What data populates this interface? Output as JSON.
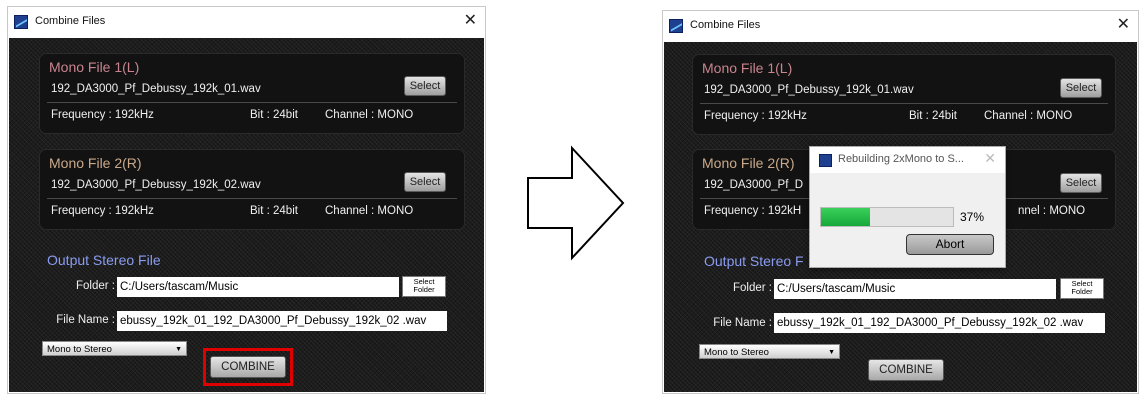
{
  "left_window": {
    "title": "Combine Files",
    "close_glyph": "✕",
    "mono1": {
      "title": "Mono File 1(L)",
      "file": "192_DA3000_Pf_Debussy_192k_01.wav",
      "select": "Select",
      "frequency": "Frequency :  192kHz",
      "bit": "Bit :  24bit",
      "channel": "Channel :  MONO"
    },
    "mono2": {
      "title": "Mono File 2(R)",
      "file": "192_DA3000_Pf_Debussy_192k_02.wav",
      "select": "Select",
      "frequency": "Frequency :  192kHz",
      "bit": "Bit :  24bit",
      "channel": "Channel :  MONO"
    },
    "output": {
      "title": "Output Stereo File",
      "folder_label": "Folder :",
      "folder": "C:/Users/tascam/Music",
      "select_folder_1": "Select",
      "select_folder_2": "Folder",
      "filename_label": "File Name :",
      "filename": "ebussy_192k_01_192_DA3000_Pf_Debussy_192k_02 .wav",
      "mode": "Mono to Stereo",
      "combine": "COMBINE"
    }
  },
  "right_window": {
    "title": "Combine Files",
    "close_glyph": "✕",
    "mono1": {
      "title": "Mono File 1(L)",
      "file": "192_DA3000_Pf_Debussy_192k_01.wav",
      "select": "Select",
      "frequency": "Frequency :  192kHz",
      "bit": "Bit :  24bit",
      "channel": "Channel :  MONO"
    },
    "mono2": {
      "title": "Mono File 2(R)",
      "file": "192_DA3000_Pf_D",
      "select": "Select",
      "frequency": "Frequency :  192kH",
      "bit": "",
      "channel": "nnel :  MONO"
    },
    "output": {
      "title": "Output Stereo F",
      "folder_label": "Folder :",
      "folder": "C:/Users/tascam/Music",
      "select_folder_1": "Select",
      "select_folder_2": "Folder",
      "filename_label": "File Name :",
      "filename": "ebussy_192k_01_192_DA3000_Pf_Debussy_192k_02 .wav",
      "mode": "Mono to Stereo",
      "combine": "COMBINE"
    },
    "progress_dialog": {
      "title": "Rebuilding 2xMono to S...",
      "progress_percent": 37,
      "progress_text": "37%",
      "abort": "Abort"
    }
  },
  "colors": {
    "mono1_title": "#c9848f",
    "mono2_title": "#c9a98a",
    "output_title": "#8a9cf0",
    "highlight": "#e00000"
  }
}
